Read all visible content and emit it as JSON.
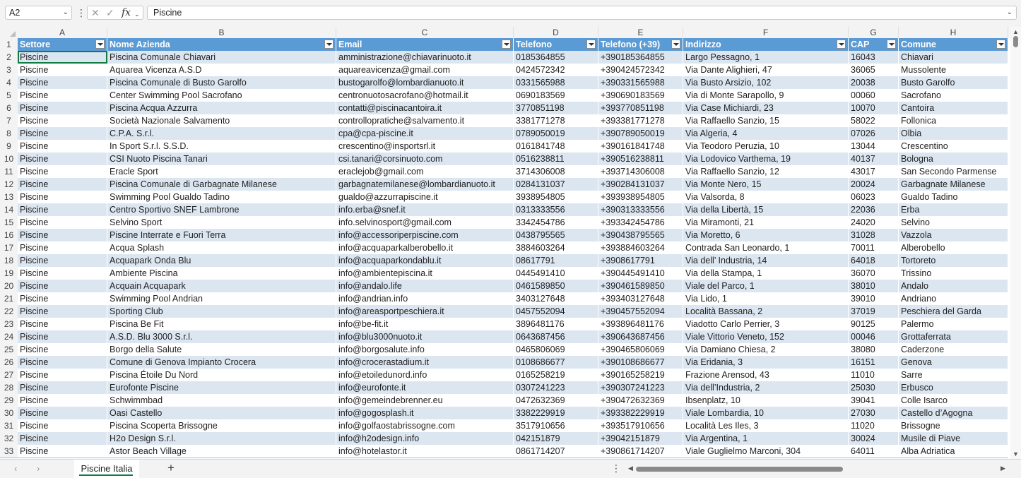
{
  "formula_bar": {
    "name_box": "A2",
    "formula": "Piscine",
    "cancel_glyph": "✕",
    "enter_glyph": "✓",
    "fx_label": "fx"
  },
  "columns": [
    "A",
    "B",
    "C",
    "D",
    "E",
    "F",
    "G",
    "H"
  ],
  "headers": [
    "Settore",
    "Nome Azienda",
    "Email",
    "Telefono",
    "Telefono (+39)",
    "Indirizzo",
    "CAP",
    "Comune"
  ],
  "rows": [
    [
      "Piscine",
      "Piscina Comunale Chiavari",
      "amministrazione@chiavarinuoto.it",
      "0185364855",
      "+390185364855",
      "Largo Pessagno, 1",
      "16043",
      "Chiavari"
    ],
    [
      "Piscine",
      "Aquarea Vicenza A.S.D",
      "aquareavicenza@gmail.com",
      "0424572342",
      "+390424572342",
      "Via Dante Alighieri, 47",
      "36065",
      "Mussolente"
    ],
    [
      "Piscine",
      "Piscina Comunale di Busto Garolfo",
      "bustogarolfo@lombardianuoto.it",
      "0331565988",
      "+390331565988",
      "Via Busto Arsizio, 102",
      "20038",
      "Busto Garolfo"
    ],
    [
      "Piscine",
      "Center Swimming Pool Sacrofano",
      "centronuotosacrofano@hotmail.it",
      "0690183569",
      "+390690183569",
      "Via di Monte Sarapollo, 9",
      "00060",
      "Sacrofano"
    ],
    [
      "Piscine",
      "Piscina Acqua Azzurra",
      "contatti@piscinacantoira.it",
      "3770851198",
      "+393770851198",
      "Via Case Michiardi, 23",
      "10070",
      "Cantoira"
    ],
    [
      "Piscine",
      "Società Nazionale Salvamento",
      "controllopratiche@salvamento.it",
      "3381771278",
      "+393381771278",
      "Via Raffaello Sanzio, 15",
      "58022",
      "Follonica"
    ],
    [
      "Piscine",
      "C.P.A. S.r.l.",
      "cpa@cpa-piscine.it",
      "0789050019",
      "+390789050019",
      "Via Algeria, 4",
      "07026",
      "Olbia"
    ],
    [
      "Piscine",
      "In Sport S.r.l. S.S.D.",
      "crescentino@insportsrl.it",
      "0161841748",
      "+390161841748",
      "Via Teodoro Peruzia, 10",
      "13044",
      "Crescentino"
    ],
    [
      "Piscine",
      "CSI Nuoto Piscina Tanari",
      "csi.tanari@corsinuoto.com",
      "0516238811",
      "+390516238811",
      "Via Lodovico Varthema, 19",
      "40137",
      "Bologna"
    ],
    [
      "Piscine",
      "Eracle Sport",
      "eraclejob@gmail.com",
      "3714306008",
      "+393714306008",
      "Via Raffaello Sanzio, 12",
      "43017",
      "San Secondo Parmense"
    ],
    [
      "Piscine",
      "Piscina Comunale di Garbagnate Milanese",
      "garbagnatemilanese@lombardianuoto.it",
      "0284131037",
      "+390284131037",
      "Via Monte Nero, 15",
      "20024",
      "Garbagnate Milanese"
    ],
    [
      "Piscine",
      "Swimming Pool Gualdo Tadino",
      "gualdo@azzurrapiscine.it",
      "3938954805",
      "+393938954805",
      "Via Valsorda, 8",
      "06023",
      "Gualdo Tadino"
    ],
    [
      "Piscine",
      "Centro Sportivo SNEF Lambrone",
      "info.erba@snef.it",
      "0313333556",
      "+390313333556",
      "Via della Libertà, 15",
      "22036",
      "Erba"
    ],
    [
      "Piscine",
      "Selvino Sport",
      "info.selvinosport@gmail.com",
      "3342454786",
      "+393342454786",
      "Via Miramonti, 21",
      "24020",
      "Selvino"
    ],
    [
      "Piscine",
      "Piscine Interrate e Fuori Terra",
      "info@accessoriperpiscine.com",
      "0438795565",
      "+390438795565",
      "Via Moretto, 6",
      "31028",
      "Vazzola"
    ],
    [
      "Piscine",
      "Acqua Splash",
      "info@acquaparkalberobello.it",
      "3884603264",
      "+393884603264",
      "Contrada San Leonardo, 1",
      "70011",
      "Alberobello"
    ],
    [
      "Piscine",
      "Acquapark Onda Blu",
      "info@acquaparkondablu.it",
      "08617791",
      "+3908617791",
      "Via dell’ Industria, 14",
      "64018",
      "Tortoreto"
    ],
    [
      "Piscine",
      "Ambiente Piscina",
      "info@ambientepiscina.it",
      "0445491410",
      "+390445491410",
      "Via della Stampa, 1",
      "36070",
      "Trissino"
    ],
    [
      "Piscine",
      "Acquain Acquapark",
      "info@andalo.life",
      "0461589850",
      "+390461589850",
      "Viale del Parco, 1",
      "38010",
      "Andalo"
    ],
    [
      "Piscine",
      "Swimming Pool Andrian",
      "info@andrian.info",
      "3403127648",
      "+393403127648",
      "Via Lido, 1",
      "39010",
      "Andriano"
    ],
    [
      "Piscine",
      "Sporting Club",
      "info@areasportpeschiera.it",
      "0457552094",
      "+390457552094",
      "Località Bassana, 2",
      "37019",
      "Peschiera del Garda"
    ],
    [
      "Piscine",
      "Piscina Be Fit",
      "info@be-fit.it",
      "3896481176",
      "+393896481176",
      "Viadotto Carlo Perrier, 3",
      "90125",
      "Palermo"
    ],
    [
      "Piscine",
      "A.S.D. Blu 3000 S.r.l.",
      "info@blu3000nuoto.it",
      "0643687456",
      "+390643687456",
      "Viale Vittorio Veneto, 152",
      "00046",
      "Grottaferrata"
    ],
    [
      "Piscine",
      "Borgo della Salute",
      "info@borgosalute.info",
      "0465806069",
      "+390465806069",
      "Via Damiano Chiesa, 2",
      "38080",
      "Caderzone"
    ],
    [
      "Piscine",
      "Comune di Genova Impianto Crocera",
      "info@crocerastadium.it",
      "0108686677",
      "+390108686677",
      "Via Eridania, 3",
      "16151",
      "Genova"
    ],
    [
      "Piscine",
      "Piscina Étoile Du Nord",
      "info@etoiledunord.info",
      "0165258219",
      "+390165258219",
      "Frazione Arensod, 43",
      "11010",
      "Sarre"
    ],
    [
      "Piscine",
      "Eurofonte Piscine",
      "info@eurofonte.it",
      "0307241223",
      "+390307241223",
      "Via dell’Industria, 2",
      "25030",
      "Erbusco"
    ],
    [
      "Piscine",
      "Schwimmbad",
      "info@gemeindebrenner.eu",
      "0472632369",
      "+390472632369",
      "Ibsenplatz, 10",
      "39041",
      "Colle Isarco"
    ],
    [
      "Piscine",
      "Oasi Castello",
      "info@gogosplash.it",
      "3382229919",
      "+393382229919",
      "Viale Lombardia, 10",
      "27030",
      "Castello d’Agogna"
    ],
    [
      "Piscine",
      "Piscina Scoperta Brissogne",
      "info@golfaostabrissogne.com",
      "3517910656",
      "+393517910656",
      "Località Les Iles, 3",
      "11020",
      "Brissogne"
    ],
    [
      "Piscine",
      "H2o Design S.r.l.",
      "info@h2odesign.info",
      "042151879",
      "+39042151879",
      "Via Argentina, 1",
      "30024",
      "Musile di Piave"
    ],
    [
      "Piscine",
      "Astor Beach Village",
      "info@hotelastor.it",
      "0861714207",
      "+390861714207",
      "Viale Guglielmo Marconi, 304",
      "64011",
      "Alba Adriatica"
    ]
  ],
  "sheet_tabs": {
    "active": "Piscine Italia",
    "add_label": "+"
  },
  "colors": {
    "header_fill": "#5b9bd5",
    "band_fill": "#dce6f1",
    "accent": "#107c41"
  },
  "icons": {
    "cancel": "close-icon",
    "enter": "check-icon",
    "function": "fx-icon",
    "filter": "filter-dropdown-icon"
  }
}
